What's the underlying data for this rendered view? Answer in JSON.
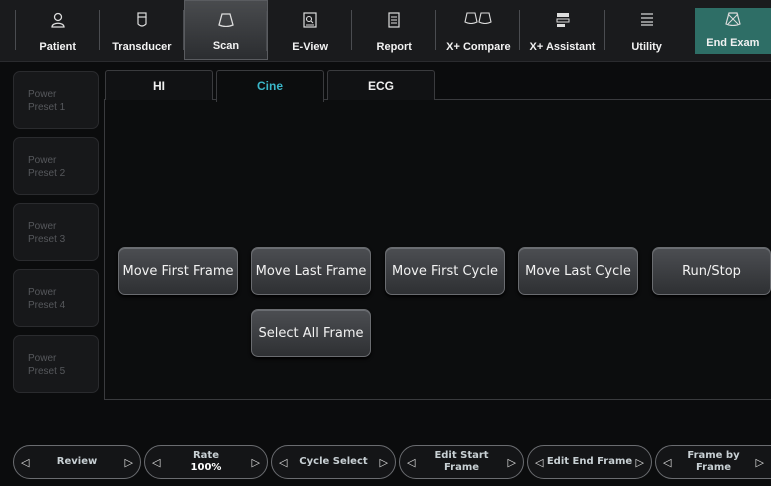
{
  "toolbar": {
    "items": [
      {
        "label": "Patient",
        "icon": "patient-icon"
      },
      {
        "label": "Transducer",
        "icon": "transducer-icon"
      },
      {
        "label": "Scan",
        "icon": "scan-icon"
      },
      {
        "label": "E-View",
        "icon": "eview-icon"
      },
      {
        "label": "Report",
        "icon": "report-icon"
      },
      {
        "label": "X+ Compare",
        "icon": "compare-icon"
      },
      {
        "label": "X+ Assistant",
        "icon": "assistant-icon"
      },
      {
        "label": "Utility",
        "icon": "utility-icon"
      },
      {
        "label": "End Exam",
        "icon": "end-exam-icon"
      }
    ]
  },
  "presets": [
    {
      "line1": "Power",
      "line2": "Preset 1"
    },
    {
      "line1": "Power",
      "line2": "Preset 2"
    },
    {
      "line1": "Power",
      "line2": "Preset 3"
    },
    {
      "line1": "Power",
      "line2": "Preset 4"
    },
    {
      "line1": "Power",
      "line2": "Preset 5"
    }
  ],
  "tabs": [
    {
      "label": "HI"
    },
    {
      "label": "Cine"
    },
    {
      "label": "ECG"
    }
  ],
  "active_tab": "Cine",
  "cine_buttons": [
    {
      "label": "Move First Frame"
    },
    {
      "label": "Move Last Frame"
    },
    {
      "label": "Move First Cycle"
    },
    {
      "label": "Move Last Cycle"
    },
    {
      "label": "Run/Stop"
    },
    {
      "label": "Select All Frame"
    }
  ],
  "bottom_controls": [
    {
      "label": "Review"
    },
    {
      "label": "Rate",
      "value": "100%"
    },
    {
      "label": "Cycle Select"
    },
    {
      "label": "Edit Start Frame"
    },
    {
      "label": "Edit End Frame"
    },
    {
      "label": "Frame by Frame"
    }
  ],
  "colors": {
    "accent": "#3ab6c8",
    "end_exam": "#2e6e66"
  }
}
